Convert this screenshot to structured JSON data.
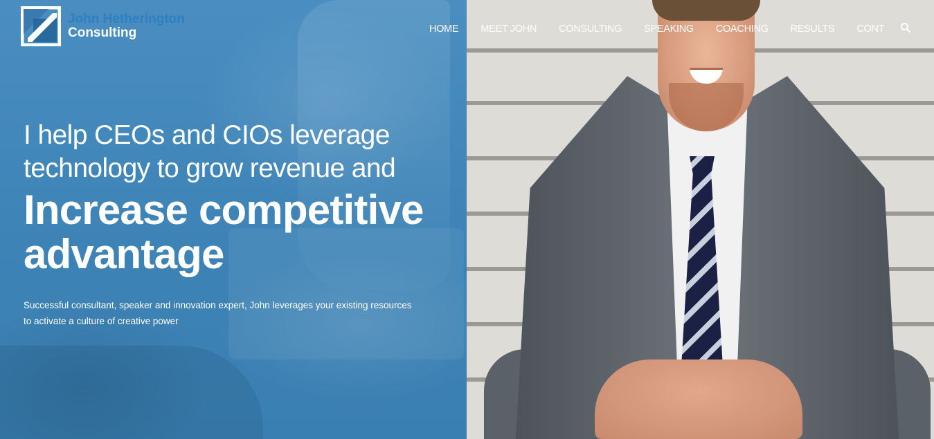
{
  "brand": {
    "line1": "John Hetherington",
    "line2": "Consulting",
    "logo_icon": "square-logo-icon"
  },
  "nav": {
    "items": [
      {
        "label": "HOME"
      },
      {
        "label": "MEET JOHN"
      },
      {
        "label": "CONSULTING"
      },
      {
        "label": "SPEAKING"
      },
      {
        "label": "COACHING"
      },
      {
        "label": "RESULTS"
      },
      {
        "label": "CONT"
      }
    ],
    "search_icon": "search-icon"
  },
  "hero": {
    "line1": "I help CEOs and CIOs leverage",
    "line2": "technology to grow revenue and",
    "bold_line1": "Increase competitive",
    "bold_line2": "advantage",
    "sub_line1": "Successful consultant, speaker and innovation expert, John leverages your existing resources",
    "sub_line2": "to activate a culture of creative power"
  },
  "colors": {
    "panel_blue": "#3f85b5",
    "brand_blue": "#2e7fc2",
    "text": "#ffffff"
  }
}
